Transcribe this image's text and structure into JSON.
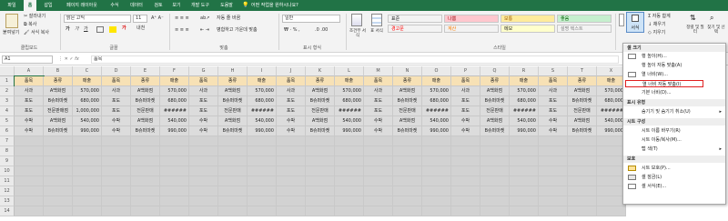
{
  "tabs": [
    "파일",
    "홈",
    "삽입",
    "페이지 레이아웃",
    "수식",
    "데이터",
    "검토",
    "보기",
    "개발 도구",
    "도움말"
  ],
  "tell_me": "어떤 작업을 원하시나요?",
  "clipboard": {
    "paste": "붙여넣기",
    "cut": "잘라내기",
    "copy": "복사",
    "format_painter": "서식 복사",
    "label": "클립보드"
  },
  "font": {
    "name": "맑은 고딕",
    "size": "11",
    "label": "글꼴"
  },
  "align": {
    "wrap": "자동 줄 바꿈",
    "merge": "병합하고 가운데 맞춤",
    "label": "맞춤"
  },
  "number": {
    "format": "일반",
    "label": "표시 형식"
  },
  "styles": {
    "cond": "조건부 서식",
    "table": "표 서식",
    "cells": [
      {
        "name": "표준",
        "bg": "#ffffff",
        "fg": "#222222"
      },
      {
        "name": "나쁨",
        "bg": "#ffc7ce",
        "fg": "#9c0006"
      },
      {
        "name": "보통",
        "bg": "#ffeb9c",
        "fg": "#9c5700"
      },
      {
        "name": "좋음",
        "bg": "#c6efce",
        "fg": "#006100"
      },
      {
        "name": "경고문",
        "bg": "#ffffff",
        "fg": "#ff0000"
      },
      {
        "name": "계산",
        "bg": "#f2f2f2",
        "fg": "#fa7d00"
      },
      {
        "name": "메모",
        "bg": "#ffffcc",
        "fg": "#222222"
      },
      {
        "name": "설명 텍스트",
        "bg": "#ffffff",
        "fg": "#7f7f7f"
      }
    ],
    "label": "스타일"
  },
  "cells_group": {
    "insert": "삽입",
    "delete": "삭제",
    "format": "서식"
  },
  "editing": {
    "autosum": "자동 합계",
    "fill": "채우기",
    "clear": "지우기",
    "sort": "정렬 및 필터",
    "find": "찾기 및 선택"
  },
  "namebox": "A1",
  "formula": "품목",
  "col_letters": [
    "A",
    "B",
    "C",
    "D",
    "E",
    "F",
    "G",
    "H",
    "I",
    "J",
    "K",
    "L",
    "M",
    "N",
    "O",
    "P",
    "Q",
    "R",
    "S",
    "T",
    "X"
  ],
  "rows": [
    [
      "품목",
      "종류",
      "매출",
      "품목",
      "종류",
      "매출",
      "품목",
      "종류",
      "매출",
      "품목",
      "종류",
      "매출",
      "품목",
      "종류",
      "매출",
      "품목",
      "종류",
      "매출",
      "품목",
      "종류",
      "매출"
    ],
    [
      "사과",
      "A백화점",
      "570,000",
      "사과",
      "A백화점",
      "570,000",
      "사과",
      "A백화점",
      "570,000",
      "사과",
      "A백화점",
      "570,000",
      "사과",
      "A백화점",
      "570,000",
      "사과",
      "A백화점",
      "570,000",
      "사과",
      "A백화점",
      "570,000"
    ],
    [
      "포도",
      "B슈퍼마켓",
      "680,000",
      "포도",
      "B슈퍼마켓",
      "680,000",
      "포도",
      "B슈퍼마켓",
      "680,000",
      "포도",
      "B슈퍼마켓",
      "680,000",
      "포도",
      "B슈퍼마켓",
      "680,000",
      "포도",
      "B슈퍼마켓",
      "680,000",
      "포도",
      "B슈퍼마켓",
      "680,000"
    ],
    [
      "포도",
      "전문판매점",
      "1,000,000",
      "포도",
      "전문판매",
      "######",
      "포도",
      "전문판매",
      "######",
      "포도",
      "전문판매",
      "######",
      "포도",
      "전문판매",
      "######",
      "포도",
      "전문판매",
      "######",
      "포도",
      "전문판매",
      "######"
    ],
    [
      "수박",
      "A백화점",
      "540,000",
      "수박",
      "A백화점",
      "540,000",
      "수박",
      "A백화점",
      "540,000",
      "수박",
      "A백화점",
      "540,000",
      "수박",
      "A백화점",
      "540,000",
      "수박",
      "A백화점",
      "540,000",
      "수박",
      "A백화점",
      "540,000"
    ],
    [
      "수박",
      "B슈퍼마켓",
      "990,000",
      "수박",
      "B슈퍼마켓",
      "990,000",
      "수박",
      "B슈퍼마켓",
      "990,000",
      "수박",
      "B슈퍼마켓",
      "990,000",
      "수박",
      "B슈퍼마켓",
      "990,000",
      "수박",
      "B슈퍼마켓",
      "990,000",
      "수박",
      "B슈퍼마켓",
      "990,000"
    ]
  ],
  "row_count": 14,
  "menu": {
    "sections": {
      "size": "셀 크기",
      "visibility": "표시 유형",
      "organize": "시트 구성",
      "protection": "보호"
    },
    "items": {
      "row_height": "행 높이(H)...",
      "autofit_row": "행 높이 자동 맞춤(A)",
      "col_width": "열 너비(W)...",
      "autofit_col": "열 너비 자동 맞춤(I)",
      "default_width": "기본 너비(D)...",
      "hide_unhide": "숨기기 및 숨기기 취소(U)",
      "rename": "시트 이름 바꾸기(R)",
      "move_copy": "시트 이동/복사(M)...",
      "tab_color": "탭 색(T)",
      "protect": "시트 보호(P)...",
      "lock": "셀 잠금(L)",
      "format_cells": "셀 서식(E)..."
    }
  }
}
